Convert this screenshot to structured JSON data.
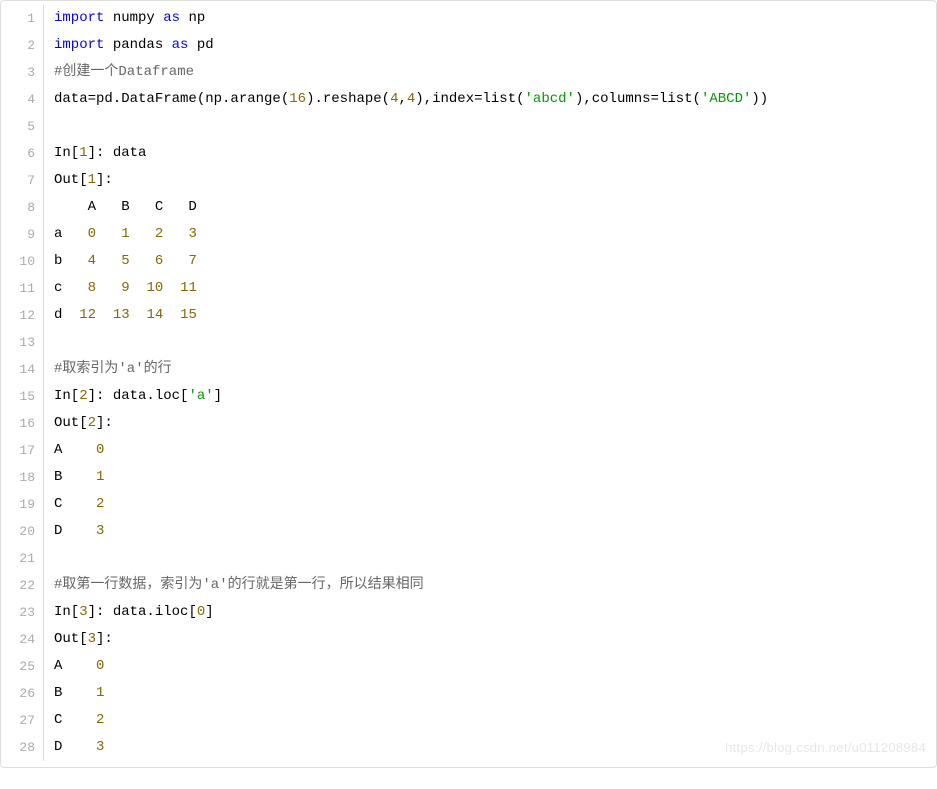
{
  "watermark": "https://blog.csdn.net/u011208984",
  "lines": [
    {
      "n": 1,
      "t": "<span class='kw'>import</span> numpy <span class='kw'>as</span> np"
    },
    {
      "n": 2,
      "t": "<span class='kw'>import</span> pandas <span class='kw'>as</span> pd"
    },
    {
      "n": 3,
      "t": "<span class='comm'>#创建一个Dataframe</span>"
    },
    {
      "n": 4,
      "t": "data=pd.DataFrame(np.arange(<span class='num'>16</span>).reshape(<span class='num'>4</span>,<span class='num'>4</span>),index=list(<span class='str'>'abcd'</span>),columns=list(<span class='str'>'ABCD'</span>))"
    },
    {
      "n": 5,
      "t": " "
    },
    {
      "n": 6,
      "t": "In[<span class='num'>1</span>]: data"
    },
    {
      "n": 7,
      "t": "Out[<span class='num'>1</span>]:"
    },
    {
      "n": 8,
      "t": "    A   B   C   D"
    },
    {
      "n": 9,
      "t": "a   <span class='num'>0</span>   <span class='num'>1</span>   <span class='num'>2</span>   <span class='num'>3</span>"
    },
    {
      "n": 10,
      "t": "b   <span class='num'>4</span>   <span class='num'>5</span>   <span class='num'>6</span>   <span class='num'>7</span>"
    },
    {
      "n": 11,
      "t": "c   <span class='num'>8</span>   <span class='num'>9</span>  <span class='num'>10</span>  <span class='num'>11</span>"
    },
    {
      "n": 12,
      "t": "d  <span class='num'>12</span>  <span class='num'>13</span>  <span class='num'>14</span>  <span class='num'>15</span>"
    },
    {
      "n": 13,
      "t": " "
    },
    {
      "n": 14,
      "t": "<span class='comm'>#取索引为'a'的行</span>"
    },
    {
      "n": 15,
      "t": "In[<span class='num'>2</span>]: data.loc[<span class='str'>'a'</span>]"
    },
    {
      "n": 16,
      "t": "Out[<span class='num'>2</span>]:"
    },
    {
      "n": 17,
      "t": "A    <span class='num'>0</span>"
    },
    {
      "n": 18,
      "t": "B    <span class='num'>1</span>"
    },
    {
      "n": 19,
      "t": "C    <span class='num'>2</span>"
    },
    {
      "n": 20,
      "t": "D    <span class='num'>3</span>"
    },
    {
      "n": 21,
      "t": " "
    },
    {
      "n": 22,
      "t": "<span class='comm'>#取第一行数据，索引为'a'的行就是第一行，所以结果相同</span>"
    },
    {
      "n": 23,
      "t": "In[<span class='num'>3</span>]: data.iloc[<span class='num'>0</span>]"
    },
    {
      "n": 24,
      "t": "Out[<span class='num'>3</span>]:"
    },
    {
      "n": 25,
      "t": "A    <span class='num'>0</span>"
    },
    {
      "n": 26,
      "t": "B    <span class='num'>1</span>"
    },
    {
      "n": 27,
      "t": "C    <span class='num'>2</span>"
    },
    {
      "n": 28,
      "t": "D    <span class='num'>3</span>"
    }
  ]
}
